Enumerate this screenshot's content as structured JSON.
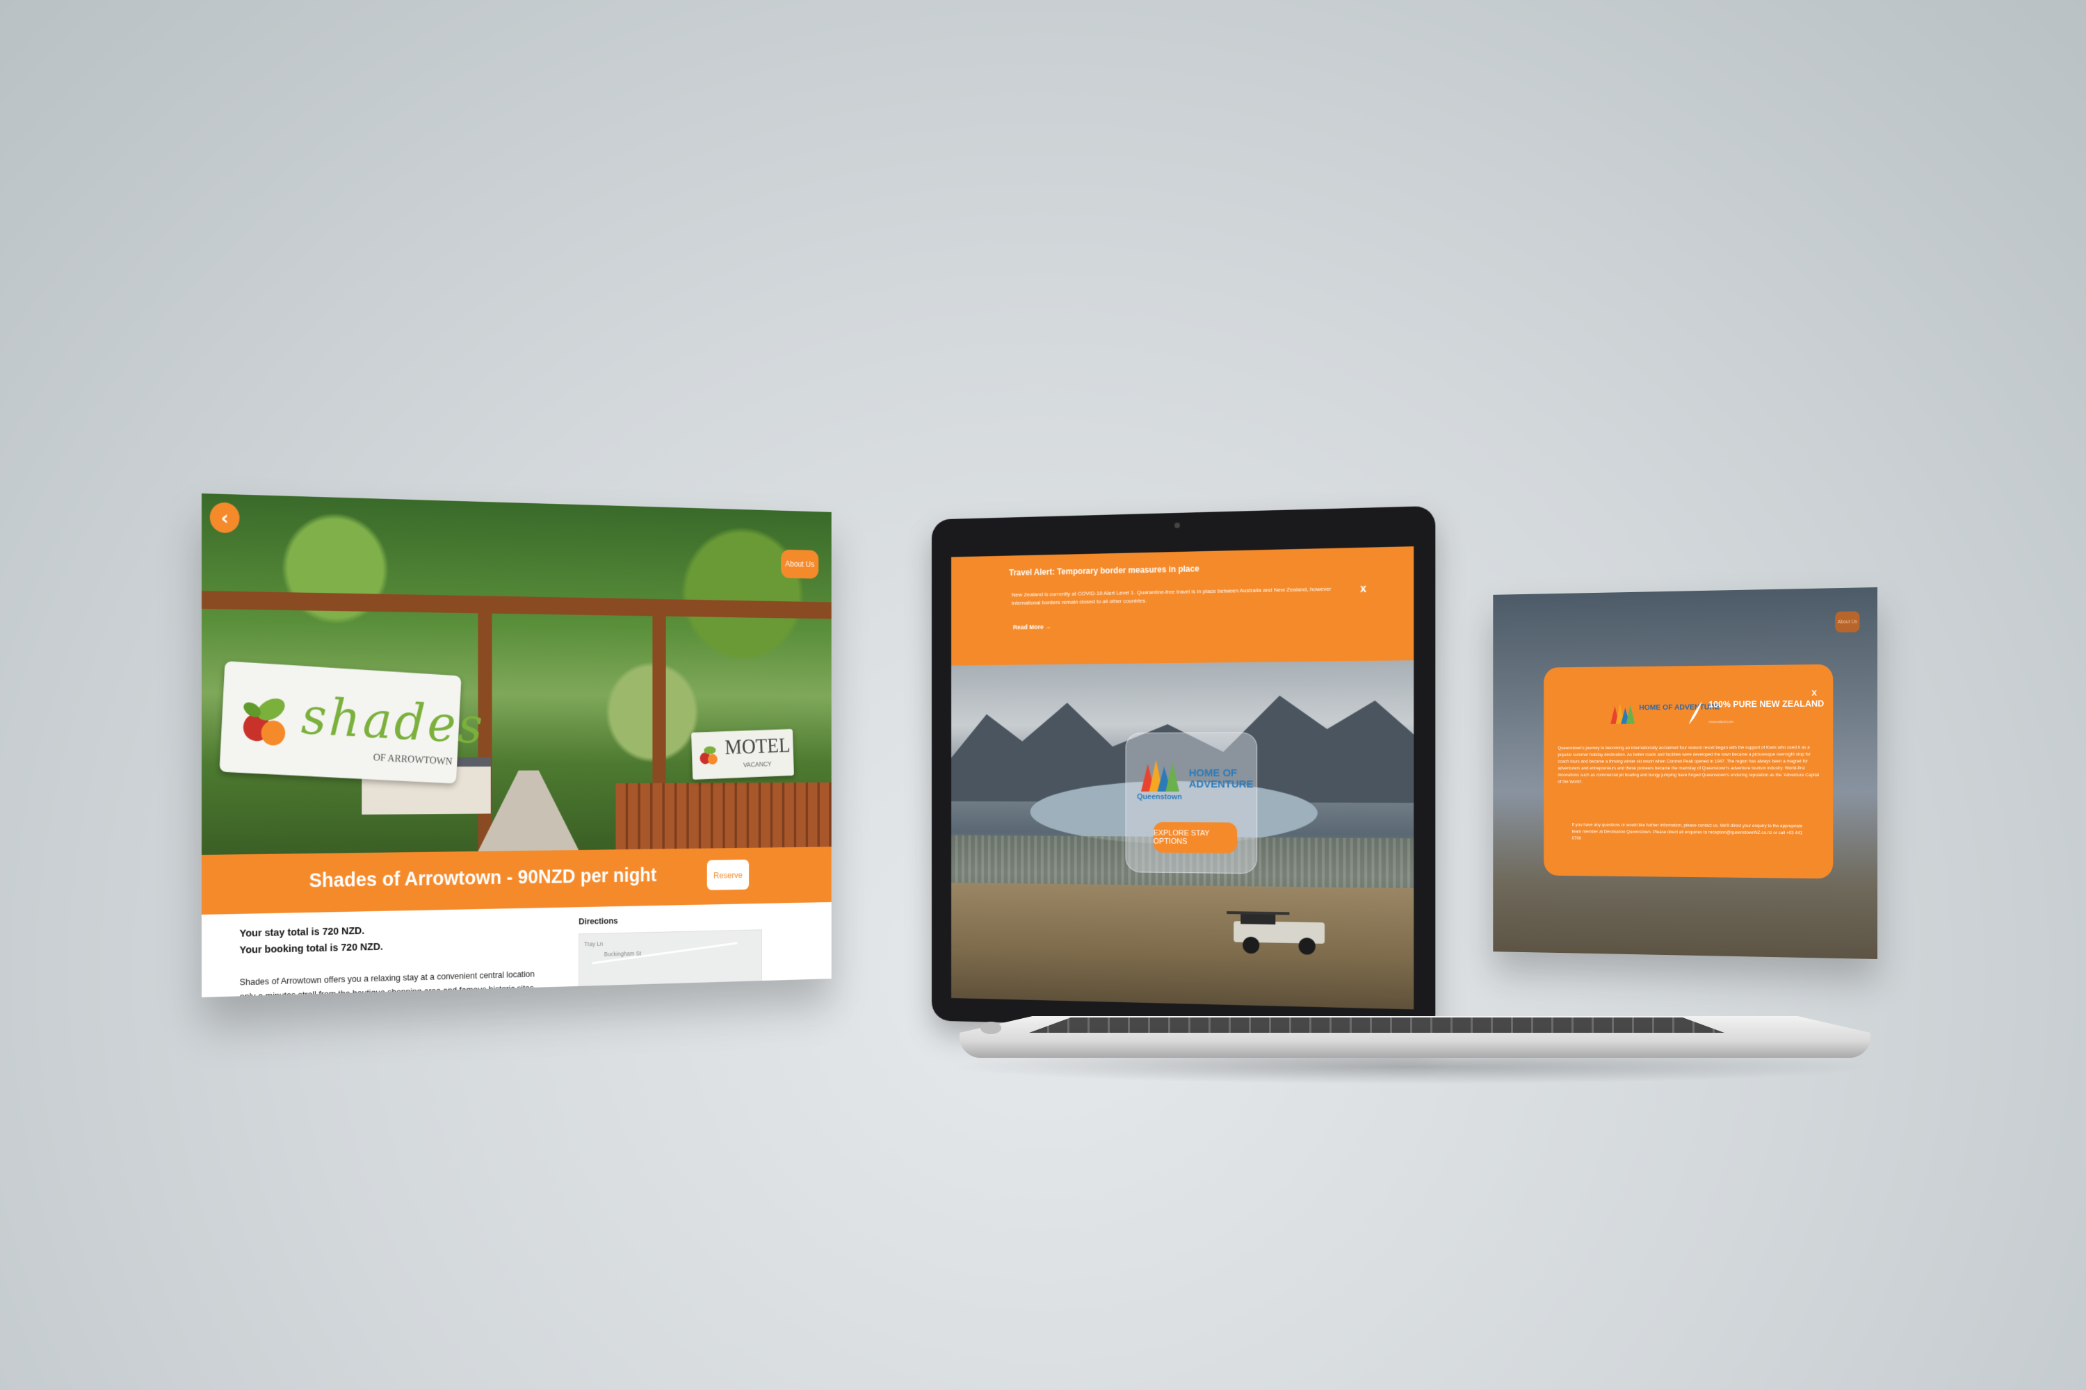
{
  "left_screen": {
    "back_icon": "chevron-left-icon",
    "about_label": "About Us",
    "sign_text": "shades",
    "sign_sub": "OF ARROWTOWN",
    "motel_text": "MOTEL",
    "motel_sub": "VACANCY",
    "title": "Shades of Arrowtown - 90NZD per night",
    "reserve_label": "Reserve",
    "stay_total": "Your stay total is 720 NZD.",
    "booking_total": "Your booking total is 720 NZD.",
    "description": "Shades of Arrowtown offers you a relaxing stay at a convenient central location only a minutes stroll from the boutique shopping area and famous historic sites, such as the Chinese miners",
    "directions_label": "Directions",
    "map_label_1": "Tray Ln",
    "map_label_2": "Buckingham St"
  },
  "laptop": {
    "alert_title": "Travel Alert: Temporary border measures in place",
    "alert_text": "New Zealand is currently at COVID-19 Alert Level 1. Quarantine-free travel is in place between Australia and New Zealand, however international borders remain closed to all other countries.",
    "read_more": "Read More →",
    "close_label": "x",
    "logo_word": "Queenstown",
    "home_of_adventure": "HOME OF ADVENTURE",
    "explore_label": "EXPLORE STAY OPTIONS"
  },
  "right_screen": {
    "about_label": "About Us",
    "close_label": "x",
    "home_of_adventure": "HOME OF ADVENTURE",
    "pure_nz": "100% PURE NEW ZEALAND",
    "pure_sub": "newzealand.com",
    "paragraph_1": "Queenstown's journey to becoming an internationally acclaimed four season resort began with the support of Kiwis who used it as a popular summer holiday destination. As better roads and facilities were developed the town became a picturesque overnight stop for coach tours and became a thriving winter ski resort when Coronet Peak opened in 1947. The region has always been a magnet for adventurers and entrepreneurs and these pioneers became the mainstay of Queenstown's adventure tourism industry. World-first innovations such as commercial jet boating and bungy jumping have forged Queenstown's enduring reputation as the 'Adventure Capital of the World'.",
    "paragraph_2": "If you have any questions or would like further information, please contact us. We'll direct your enquiry to the appropriate team member at Destination Queenstown. Please direct all enquiries to reception@queenstownNZ.co.nz or call +03 441 0700"
  },
  "colors": {
    "accent_orange": "#f58a2b",
    "queenstown_blue": "#2d7ab8",
    "sign_green": "#7bb03c"
  }
}
